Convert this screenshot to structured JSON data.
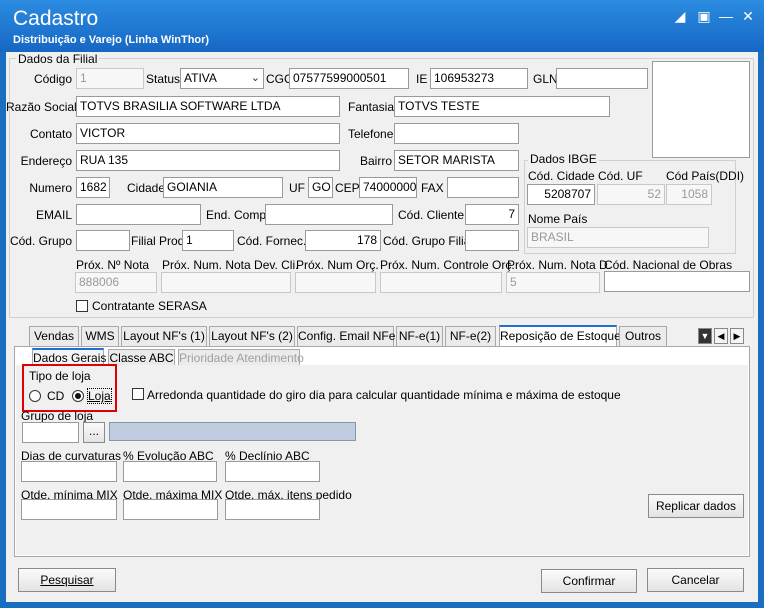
{
  "window": {
    "title": "Cadastro",
    "subtitle": "Distribuição e Varejo (Linha WinThor)"
  },
  "filial": {
    "group_title": "Dados da Filial",
    "codigo_label": "Código",
    "codigo": "1",
    "status_label": "Status",
    "status": "ATIVA",
    "cgc_label": "CGC",
    "cgc": "07577599000501",
    "ie_label": "IE",
    "ie": "106953273",
    "gln_label": "GLN",
    "gln": "",
    "razao_label": "Razão Social",
    "razao": "TOTVS BRASILIA SOFTWARE LTDA",
    "fantasia_label": "Fantasia",
    "fantasia": "TOTVS TESTE",
    "contato_label": "Contato",
    "contato": "VICTOR",
    "telefone_label": "Telefone",
    "telefone": "",
    "endereco_label": "Endereço",
    "endereco": "RUA 135",
    "bairro_label": "Bairro",
    "bairro": "SETOR MARISTA",
    "numero_label": "Numero",
    "numero": "1682",
    "cidade_label": "Cidade",
    "cidade": "GOIANIA",
    "uf_label": "UF",
    "uf": "GO",
    "cep_label": "CEP",
    "cep": "74000000",
    "fax_label": "FAX",
    "fax": "",
    "email_label": "EMAIL",
    "email": "",
    "endcomp_label": "End. Comp.",
    "endcomp": "",
    "codcliente_label": "Cód. Cliente",
    "codcliente": "7",
    "codgrupo_label": "Cód. Grupo",
    "codgrupo": "",
    "filialprod_label": "Filial Prod.",
    "filialprod": "1",
    "codfornec_label": "Cód. Fornec.",
    "codfornec": "178",
    "codgrupofilial_label": "Cód. Grupo Filial",
    "codgrupofilial": "",
    "proxnf_label": "Próx. Nº Nota",
    "proxnf": "888006",
    "proxnfdev_label": "Próx. Num. Nota Dev. Cli.",
    "proxnfdev": "",
    "proxorc_label": "Próx. Num Orç.",
    "proxorc": "",
    "proxctrl_label": "Próx. Num. Controle Orç.",
    "proxctrl": "",
    "proxnfd_label": "Próx. Num. Nota D.",
    "proxnfd": "5",
    "codobras_label": "Cód. Nacional de Obras",
    "codobras": "",
    "serasa_label": "Contratante SERASA"
  },
  "ibge": {
    "group_title": "Dados IBGE",
    "codcidade_label": "Cód. Cidade",
    "codcidade": "5208707",
    "coduf_label": "Cód. UF",
    "coduf": "52",
    "codpais_label": "Cód País(DDI)",
    "codpais": "1058",
    "nomepais_label": "Nome País",
    "nomepais": "BRASIL"
  },
  "tabs": [
    "Vendas",
    "WMS",
    "Layout NF's (1)",
    "Layout NF's (2)",
    "Config. Email NFe",
    "NF-e(1)",
    "NF-e(2)",
    "Reposição de Estoque",
    "Outros"
  ],
  "subtabs": [
    "Dados Gerais",
    "Classe ABC",
    "Prioridade Atendimento"
  ],
  "reposicao": {
    "tipo_title": "Tipo de loja",
    "cd_label": "CD",
    "loja_label": "Loja",
    "arredonda_label": "Arredonda quantidade do giro dia  para calcular quantidade mínima e máxima de estoque",
    "grupo_label": "Grupo de loja",
    "grupo_value": "",
    "browse_label": "...",
    "dias_label": "Dias de curvaturas",
    "evol_label": "% Evolução ABC",
    "decl_label": "% Declínio ABC",
    "qmin_label": "Qtde. mínima MIX",
    "qmax_label": "Qtde. máxima MIX",
    "qmaxped_label": "Qtde. máx. itens pedido",
    "replicar_label": "Replicar dados"
  },
  "buttons": {
    "pesquisar": "Pesquisar",
    "confirmar": "Confirmar",
    "cancelar": "Cancelar"
  },
  "colors": {
    "titlebar": "#1a6ec0",
    "highlight": "#e00000",
    "grupo_bar": "#c0cce0"
  }
}
